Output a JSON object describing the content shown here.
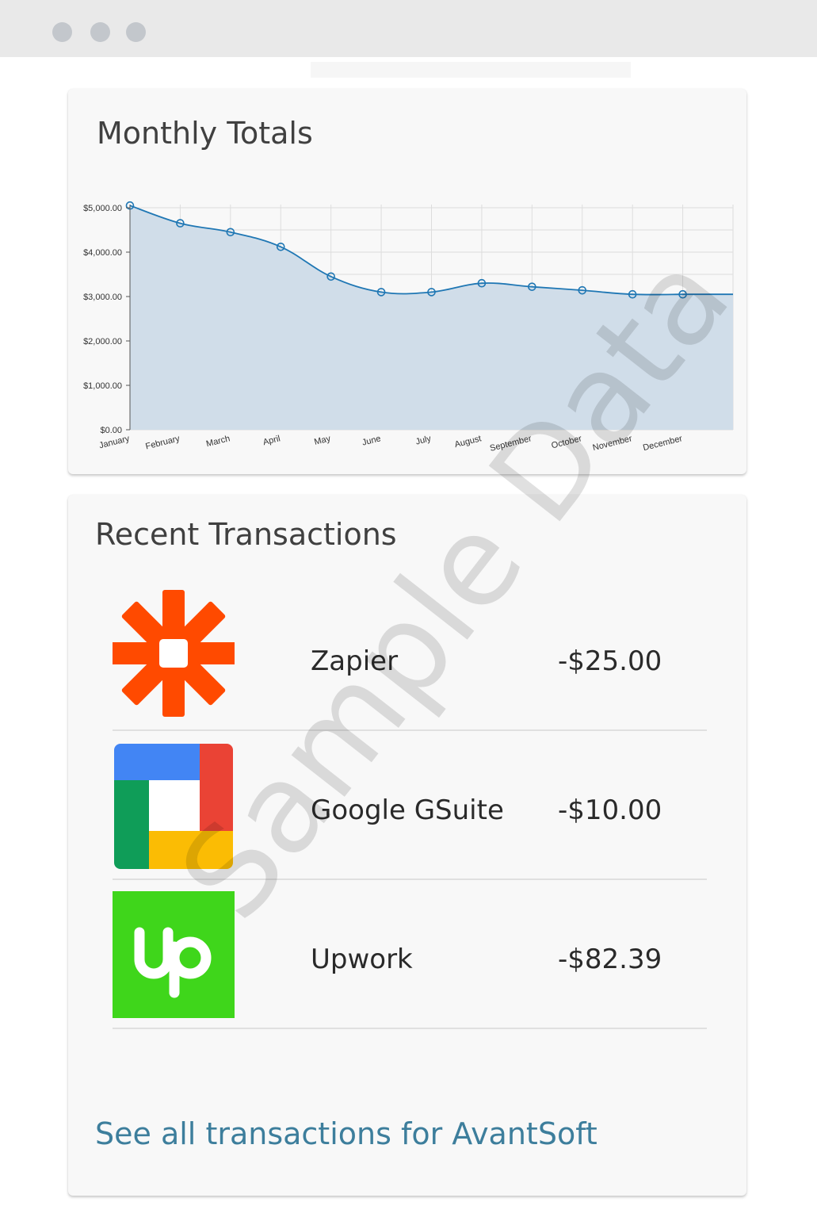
{
  "window": {
    "controls": [
      "dot",
      "dot",
      "dot"
    ]
  },
  "monthly_card": {
    "title": "Monthly Totals"
  },
  "chart_data": {
    "type": "area",
    "categories": [
      "January",
      "February",
      "March",
      "April",
      "May",
      "June",
      "July",
      "August",
      "September",
      "October",
      "November",
      "December"
    ],
    "series": [
      {
        "values": [
          5050,
          4650,
          4450,
          4120,
          3450,
          3100,
          3100,
          3300,
          3220,
          3140,
          3050,
          3050
        ]
      }
    ],
    "y_ticks": [
      "$0.00",
      "$1,000.00",
      "$2,000.00",
      "$3,000.00",
      "$4,000.00",
      "$5,000.00"
    ],
    "ylim": [
      0,
      5000
    ],
    "grid": true,
    "colors": {
      "line": "#1f77b4",
      "fill": "#d0dde9",
      "grid": "#dddddd"
    }
  },
  "transactions_card": {
    "title": "Recent Transactions",
    "rows": [
      {
        "name": "Zapier",
        "amount": "-$25.00",
        "logo": "zapier-logo"
      },
      {
        "name": "Google GSuite",
        "amount": "-$10.00",
        "logo": "gsuite-logo"
      },
      {
        "name": "Upwork",
        "amount": "-$82.39",
        "logo": "upwork-logo"
      }
    ],
    "see_all_link": "See all transactions for AvantSoft"
  },
  "watermark": "Sample Data",
  "brand_colors": {
    "zapier": "#ff4a00",
    "upwork": "#3fd61b",
    "link": "#3d7e9c"
  }
}
